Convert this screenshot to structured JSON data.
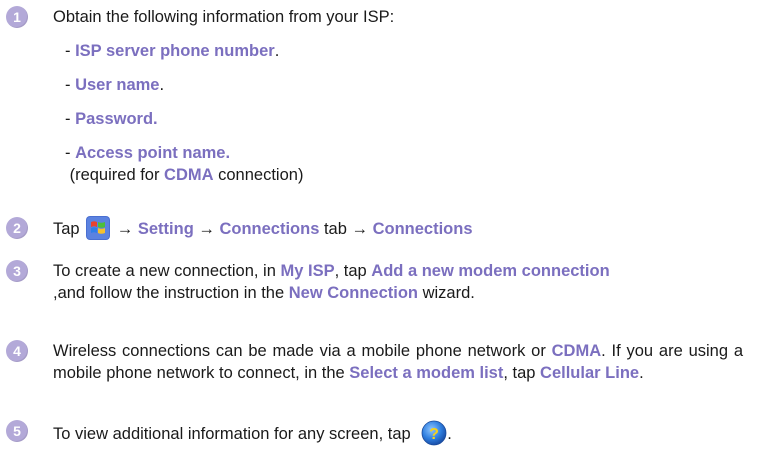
{
  "steps": [
    {
      "number": "1",
      "intro": "Obtain the following information from your ISP:",
      "items": [
        {
          "prefix": "- ",
          "label": "ISP server phone number",
          "suffix": "."
        },
        {
          "prefix": "- ",
          "label": "User name",
          "suffix": "."
        },
        {
          "prefix": "- ",
          "label": "Password.",
          "suffix": ""
        },
        {
          "prefix": "- ",
          "label": "Access point name.",
          "suffix": ""
        }
      ],
      "note_prefix": " (required for ",
      "note_bold": "CDMA",
      "note_suffix": " connection)"
    },
    {
      "number": "2",
      "tap": "Tap ",
      "start_icon": "windows-start-icon",
      "arrow1": " → ",
      "setting": "Setting",
      "arrow2": " → ",
      "connections_tab": "Connections",
      "tab_word": " tab → ",
      "connections": "Connections"
    },
    {
      "number": "3",
      "text1": "To create a new connection, in ",
      "my_isp": "My ISP",
      "text2": ", tap ",
      "add_modem": "Add a new modem connection",
      "line2_1": ",and follow the instruction in the ",
      "new_connection": "New Connection",
      "line2_2": " wizard."
    },
    {
      "number": "4",
      "t1": "Wireless connections can be made via a mobile phone network or ",
      "cdma": "CDMA",
      "t2": ". If you are using a mobile phone network to connect, in the ",
      "select_modem": "Select a modem list",
      "t3": ", tap ",
      "cellular": "Cellular Line",
      "t4": "."
    },
    {
      "number": "5",
      "text": "To view additional information for any screen, tap ",
      "help_icon": "help-icon",
      "end": "."
    }
  ]
}
